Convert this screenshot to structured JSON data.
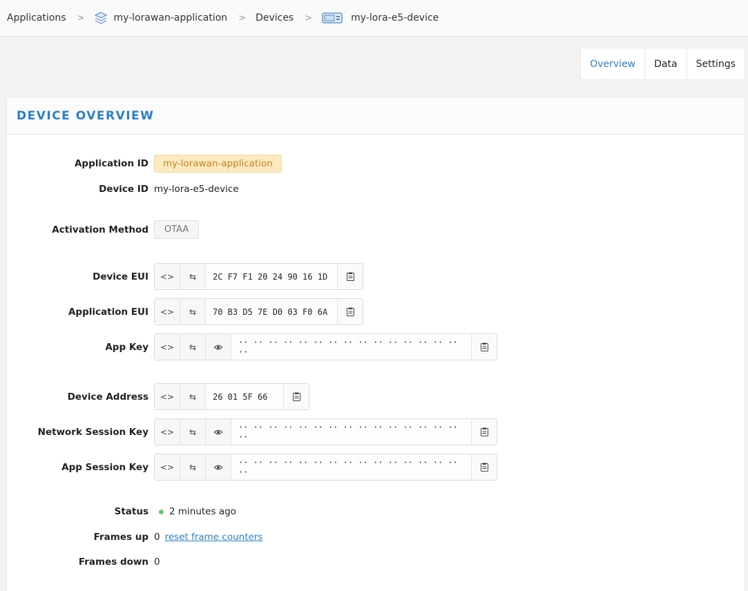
{
  "breadcrumb": {
    "applications": "Applications",
    "application": "my-lorawan-application",
    "devices": "Devices",
    "device": "my-lora-e5-device",
    "separator": ">"
  },
  "tabs": [
    "Overview",
    "Data",
    "Settings"
  ],
  "overview": {
    "title": "DEVICE OVERVIEW",
    "application_id": {
      "label": "Application ID",
      "value": "my-lorawan-application"
    },
    "device_id": {
      "label": "Device ID",
      "value": "my-lora-e5-device"
    },
    "activation": {
      "label": "Activation Method",
      "value": "OTAA"
    },
    "device_eui": {
      "label": "Device EUI",
      "value": "2C F7 F1 20 24 90 16 1D"
    },
    "application_eui": {
      "label": "Application EUI",
      "value": "70 B3 D5 7E D0 03 F0 6A"
    },
    "app_key": {
      "label": "App Key",
      "value": "·· ·· ·· ·· ·· ·· ·· ·· ·· ·· ·· ·· ·· ·· ·· ··"
    },
    "device_address": {
      "label": "Device Address",
      "value": "26 01 5F 66"
    },
    "nwk_skey": {
      "label": "Network Session Key",
      "value": "·· ·· ·· ·· ·· ·· ·· ·· ·· ·· ·· ·· ·· ·· ·· ··"
    },
    "app_skey": {
      "label": "App Session Key",
      "value": "·· ·· ·· ·· ·· ·· ·· ·· ·· ·· ·· ·· ·· ·· ·· ··"
    },
    "status": {
      "label": "Status",
      "value": "2 minutes ago",
      "color": "#5cd16a"
    },
    "frames_up": {
      "label": "Frames up",
      "value": "0",
      "link": "reset frame counters"
    },
    "frames_down": {
      "label": "Frames down",
      "value": "0"
    }
  },
  "icons": {
    "format": "code-icon",
    "swap": "swap-icon",
    "reveal": "eye-icon",
    "copy": "clipboard-icon",
    "application": "layers-icon",
    "device": "device-icon"
  },
  "colors": {
    "accent": "#2a7fc9",
    "app_tag_bg": "#fde9c2",
    "app_tag_text": "#c8841a",
    "status": "#5cd16a"
  }
}
